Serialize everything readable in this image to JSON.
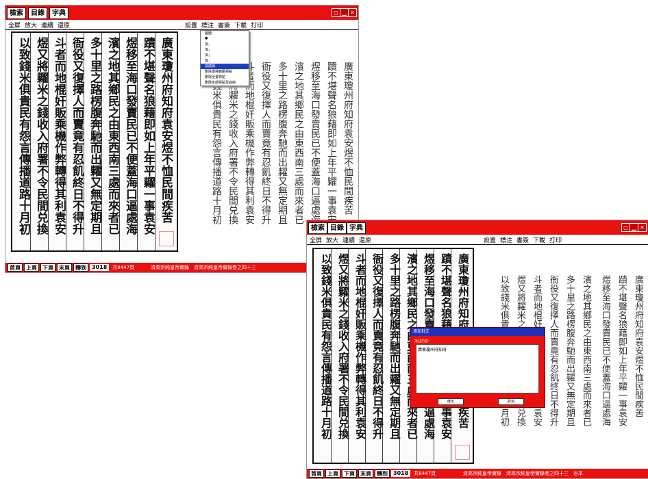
{
  "nav_buttons": [
    "檢索",
    "目錄",
    "字典"
  ],
  "left_menu": [
    "全屏",
    "放大",
    "連續",
    "還原"
  ],
  "right_menu": [
    "設置",
    "標注",
    "書簽",
    "下載",
    "打印"
  ],
  "window_controls": {
    "restore": "◻",
    "minimize": "▁",
    "close": "✕"
  },
  "status_buttons": [
    "首頁",
    "上頁",
    "下頁",
    "末頁",
    "轉到"
  ],
  "page_number": "3018",
  "total_pages": "共8447頁",
  "book_title_1": "清高宗純皇帝實錄　清高宗純皇帝實錄卷之四十三",
  "book_title_2": "清高宗純皇帝實錄　清高宗純皇帝實錄卷之四十三　谷本",
  "columns": [
    "廣東瓊州府知府袁安煜不恤民間疾苦",
    "蹟不堪聲名狼藉即如上年平糶一事袁安",
    "煜移至海口發賣民已不便蓋海口逼處海",
    "濱之地其鄉民之由東西南三處而來者已",
    "多十里之路楞腹奔馳而出糶又無定期且",
    "衙役又復擇人而賣竟有忍飢終日不得升",
    "斗者而地棍奸販乘機作弊轉得其利袁安",
    "煜又將糶米之錢收入府署不令民間兑換",
    "以致錢米俱貴民有怨言傳播道路十月初"
  ],
  "annotation_menu": [
    "圓圈",
    "●",
    "加、",
    "加，",
    "加；",
    "加：",
    "加底線",
    "刪除選擇範圍標點",
    "刪除全書標點",
    "刪除全部標點及底線"
  ],
  "dialog": {
    "title": "添加批注",
    "label": "批註內容：",
    "content": "廣東瓊州府知府",
    "ok": "確定",
    "cancel": "取消"
  },
  "colors": {
    "chrome": "#e8110f",
    "highlight": "#1a3fbf",
    "dialog_title": "#1f2fbd"
  }
}
